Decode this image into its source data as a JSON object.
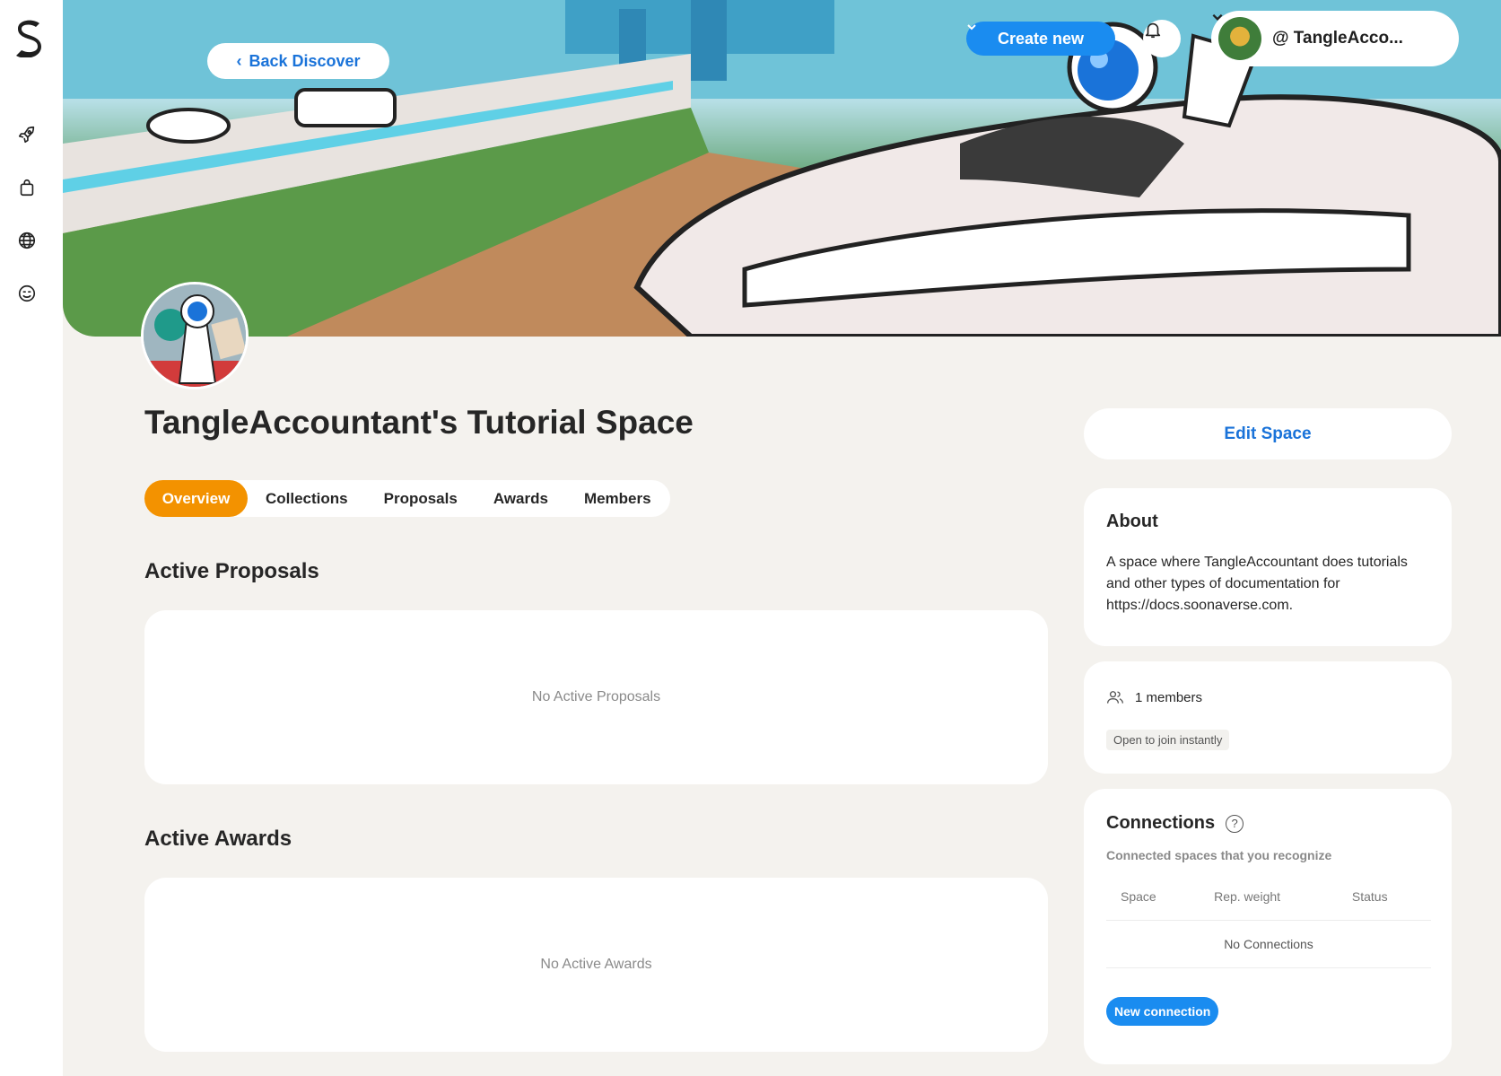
{
  "banner": {
    "back_label": "Back Discover"
  },
  "header": {
    "create_new_label": "Create new",
    "user_name": "@ TangleAcco..."
  },
  "sidebar": {
    "items": [
      {
        "icon": "rocket-icon"
      },
      {
        "icon": "shopping-bag-icon"
      },
      {
        "icon": "globe-icon"
      },
      {
        "icon": "smiley-icon"
      }
    ]
  },
  "space": {
    "title": "TangleAccountant's Tutorial Space"
  },
  "tabs": [
    {
      "label": "Overview",
      "active": true
    },
    {
      "label": "Collections"
    },
    {
      "label": "Proposals"
    },
    {
      "label": "Awards"
    },
    {
      "label": "Members"
    }
  ],
  "main": {
    "proposals_title": "Active Proposals",
    "proposals_empty": "No Active Proposals",
    "awards_title": "Active Awards",
    "awards_empty": "No Active Awards"
  },
  "right": {
    "edit_label": "Edit Space",
    "about_title": "About",
    "about_text": "A space where TangleAccountant does tutorials and other types of documentation for https://docs.soonaverse.com.",
    "members_text": "1 members",
    "open_tag": "Open to join instantly",
    "connections_title": "Connections",
    "connections_sub": "Connected spaces that you recognize",
    "table_headers": [
      "Space",
      "Rep. weight",
      "Status"
    ],
    "no_connections": "No Connections",
    "new_connection_label": "New connection"
  },
  "colors": {
    "accent_blue": "#1a8cf0",
    "link_blue": "#1a73d9",
    "active_tab": "#f39200",
    "background": "#f4f2ee"
  }
}
